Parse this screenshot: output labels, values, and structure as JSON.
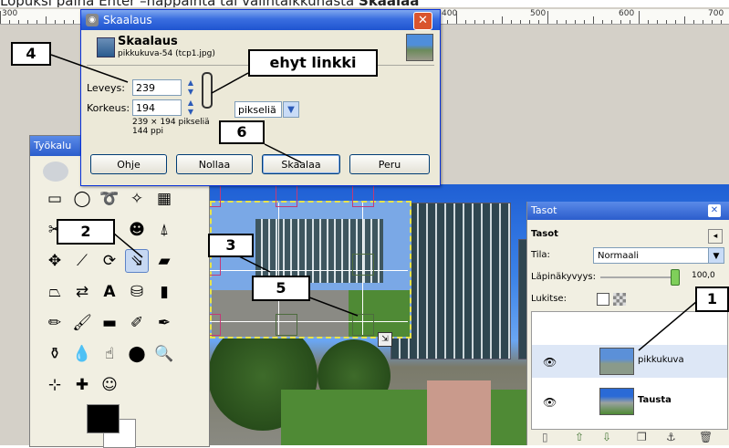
{
  "caption": {
    "text": "Lopuksi paina Enter –näppäintä tai valintaikkunasta",
    "bold": "Skaalaa"
  },
  "ruler": {
    "labels": [
      "300",
      "400",
      "500",
      "600",
      "700"
    ]
  },
  "dialog": {
    "window_title": "Skaalaus",
    "heading": "Skaalaus",
    "subtitle": "pikkukuva-54 (tcp1.jpg)",
    "width_label": "Leveys:",
    "width_value": "239",
    "height_label": "Korkeus:",
    "height_value": "194",
    "unit": "pikseliä",
    "size_info": "239 × 194 pikseliä",
    "ppi_info": "144 ppi",
    "buttons": {
      "help": "Ohje",
      "reset": "Nollaa",
      "scale": "Skaalaa",
      "cancel": "Peru"
    }
  },
  "toolbox": {
    "title": "Työkalu"
  },
  "layers_panel": {
    "title": "Tasot",
    "section_heading": "Tasot",
    "mode_label": "Tila:",
    "mode_value": "Normaali",
    "opacity_label": "Läpinäkyvyys:",
    "opacity_value": "100,0",
    "lock_label": "Lukitse:",
    "layers": [
      {
        "name": "pikkukuva",
        "selected": true
      },
      {
        "name": "Tausta",
        "selected": false
      }
    ]
  },
  "callouts": {
    "c1": "1",
    "c2": "2",
    "c3": "3",
    "c4": "4",
    "c5": "5",
    "c6": "6",
    "chain_note": "ehyt linkki"
  },
  "colors": {
    "titlebar": "#2b5dcc",
    "callout_border": "#000000",
    "handle": "#c23a77"
  }
}
